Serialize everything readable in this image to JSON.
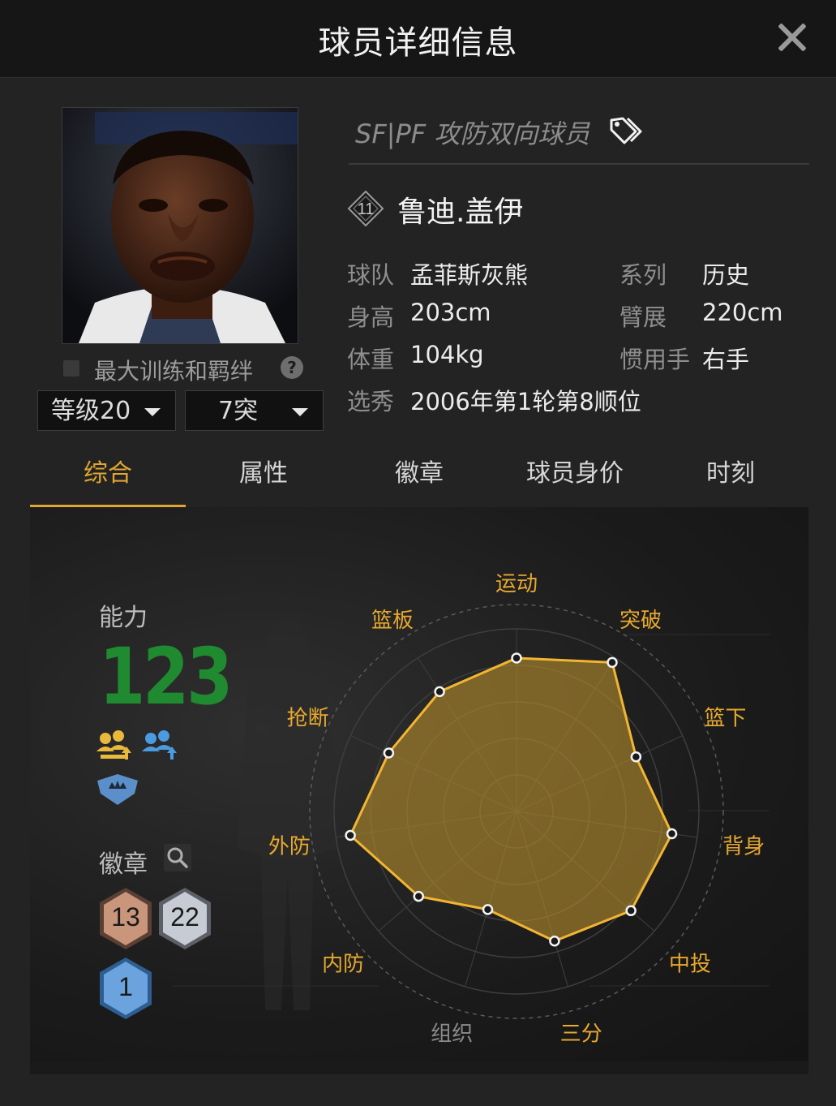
{
  "header": {
    "title": "球员详细信息",
    "close_icon": "close-icon"
  },
  "player": {
    "role": "SF|PF 攻防双向球员",
    "jersey_number": "11",
    "name": "鲁迪.盖伊",
    "info": [
      {
        "label": "球队",
        "value": "孟菲斯灰熊"
      },
      {
        "label": "系列",
        "value": "历史"
      },
      {
        "label": "身高",
        "value": "203cm"
      },
      {
        "label": "臂展",
        "value": "220cm"
      },
      {
        "label": "体重",
        "value": "104kg"
      },
      {
        "label": "惯用手",
        "value": "右手"
      },
      {
        "label": "选秀",
        "value": "2006年第1轮第8顺位"
      }
    ]
  },
  "training": {
    "label": "最大训练和羁绊",
    "checked": false,
    "help": "?"
  },
  "selects": {
    "level": "等级20",
    "breakthrough": "7突"
  },
  "tabs": [
    {
      "label": "综合",
      "active": true
    },
    {
      "label": "属性",
      "active": false
    },
    {
      "label": "徽章",
      "active": false
    },
    {
      "label": "球员身价",
      "active": false
    },
    {
      "label": "时刻",
      "active": false
    }
  ],
  "summary": {
    "ability_label": "能力",
    "ability_value": "123",
    "badge_label": "徽章",
    "badges": [
      {
        "count": "13",
        "tier": "bronze",
        "color": "#c9967c"
      },
      {
        "count": "22",
        "tier": "silver",
        "color": "#c7cbd3"
      },
      {
        "count": "1",
        "tier": "blue",
        "color": "#6aa3dd"
      }
    ]
  },
  "chart_data": {
    "type": "radar",
    "axes": [
      "运动",
      "突破",
      "篮下",
      "背身",
      "中投",
      "三分",
      "组织",
      "内防",
      "外防",
      "抢断",
      "篮板"
    ],
    "values": [
      0.84,
      0.97,
      0.72,
      0.86,
      0.83,
      0.74,
      0.56,
      0.71,
      0.92,
      0.77,
      0.78
    ],
    "range": [
      0,
      1
    ],
    "grid_rings": 5,
    "colors": {
      "fill": "#b38a2c",
      "stroke": "#f2b533",
      "label": "#e8a92e",
      "label_dim": "#8b8b8b"
    }
  }
}
